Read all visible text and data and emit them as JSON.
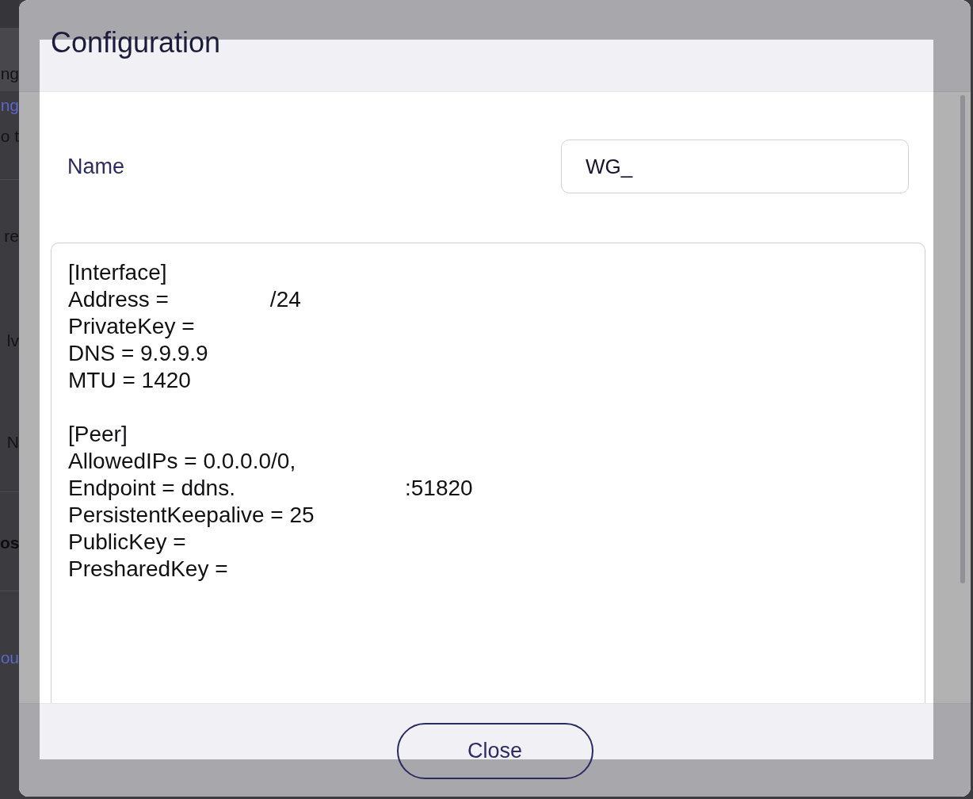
{
  "background_page": {
    "fragments": [
      {
        "kind": "plain",
        "text": "ng"
      },
      {
        "kind": "link",
        "text": "ng"
      },
      {
        "kind": "plain",
        "text": "o t"
      },
      {
        "kind": "plain",
        "text": "re"
      },
      {
        "kind": "plain",
        "text": "lv"
      },
      {
        "kind": "plain",
        "text": "N"
      },
      {
        "kind": "bold",
        "text": "os"
      },
      {
        "kind": "link",
        "text": "ou"
      }
    ]
  },
  "dialog": {
    "title": "Configuration",
    "name_field": {
      "label": "Name",
      "value": "WG_"
    },
    "config": {
      "sections": [
        {
          "title": "[Interface]",
          "lines": [
            [
              "Address =",
              "/24"
            ],
            [
              "PrivateKey ="
            ],
            [
              "DNS = 9.9.9.9"
            ],
            [
              "MTU = 1420"
            ]
          ]
        },
        {
          "title": "[Peer]",
          "lines": [
            [
              "AllowedIPs = 0.0.0.0/0,"
            ],
            [
              "Endpoint = ddns.",
              ":51820"
            ],
            [
              "PersistentKeepalive = 25"
            ],
            [
              "PublicKey ="
            ],
            [
              "PresharedKey ="
            ]
          ]
        }
      ]
    },
    "buttons": [
      {
        "label": "Close"
      }
    ]
  }
}
